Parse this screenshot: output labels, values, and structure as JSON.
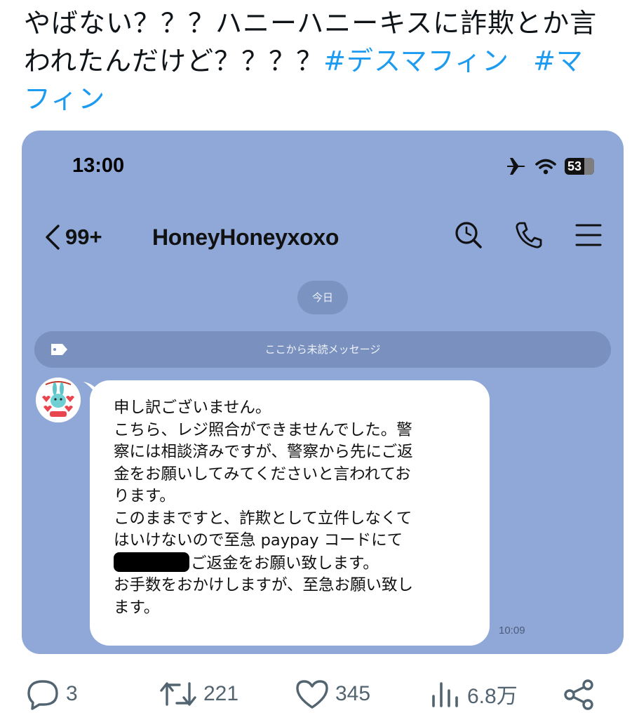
{
  "tweet": {
    "line1": "やばない？？？ハニーハニーキスに詐欺とか言",
    "line2": "われたんだけど？？？？",
    "hashtag1": "#デスマフィン",
    "hashtag2_part1": "#マ",
    "hashtag2_part2": "フィン"
  },
  "screenshot": {
    "status_time": "13:00",
    "battery_level": "53",
    "header": {
      "back_count": "99+",
      "chat_name": "HoneyHoneyxoxo"
    },
    "date_pill": "今日",
    "unread_bar": "ここから未読メッセージ",
    "message": {
      "lines": [
        "申し訳ございません。",
        "こちら、レジ照合ができませんでした。警",
        "察には相談済みですが、警察から先にご返",
        "金をお願いしてみてくださいと言われてお",
        "ります。",
        "このままですと、詐欺として立件しなくて",
        "はいけないので至急 paypay コードにて"
      ],
      "redacted_line_suffix": "ご返金をお願い致します。",
      "lines_after": [
        "お手数をおかけしますが、至急お願い致し",
        "ます。"
      ],
      "time": "10:09"
    },
    "colors": {
      "chat_background": "#8fa8d8",
      "bubble": "#ffffff"
    }
  },
  "actions": {
    "replies": "3",
    "retweets": "221",
    "likes": "345",
    "views": "6.8万"
  },
  "colors": {
    "hashtag": "#1d9bf0",
    "action_gray": "#536471"
  }
}
